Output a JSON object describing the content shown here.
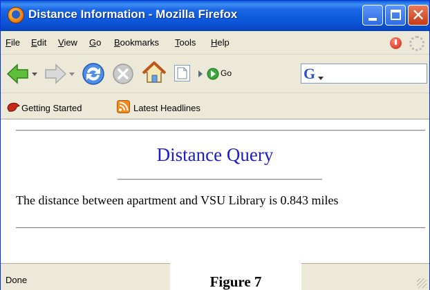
{
  "window": {
    "title": "Distance Information - Mozilla Firefox"
  },
  "menu": {
    "items": [
      "File",
      "Edit",
      "View",
      "Go",
      "Bookmarks",
      "Tools",
      "Help"
    ]
  },
  "toolbar": {
    "go_label": "Go",
    "search_engine_glyph": "G"
  },
  "bookmarks": {
    "items": [
      "Getting Started",
      "Latest Headlines"
    ]
  },
  "page": {
    "heading": "Distance Query",
    "distance_sentence": "The distance between apartment and VSU Library is 0.843 miles"
  },
  "status": {
    "text": "Done"
  },
  "caption": {
    "text": "Figure 7"
  },
  "colors": {
    "titlebar": "#0b55d8",
    "heading": "#1c1cc8",
    "chrome": "#ece9d8"
  }
}
